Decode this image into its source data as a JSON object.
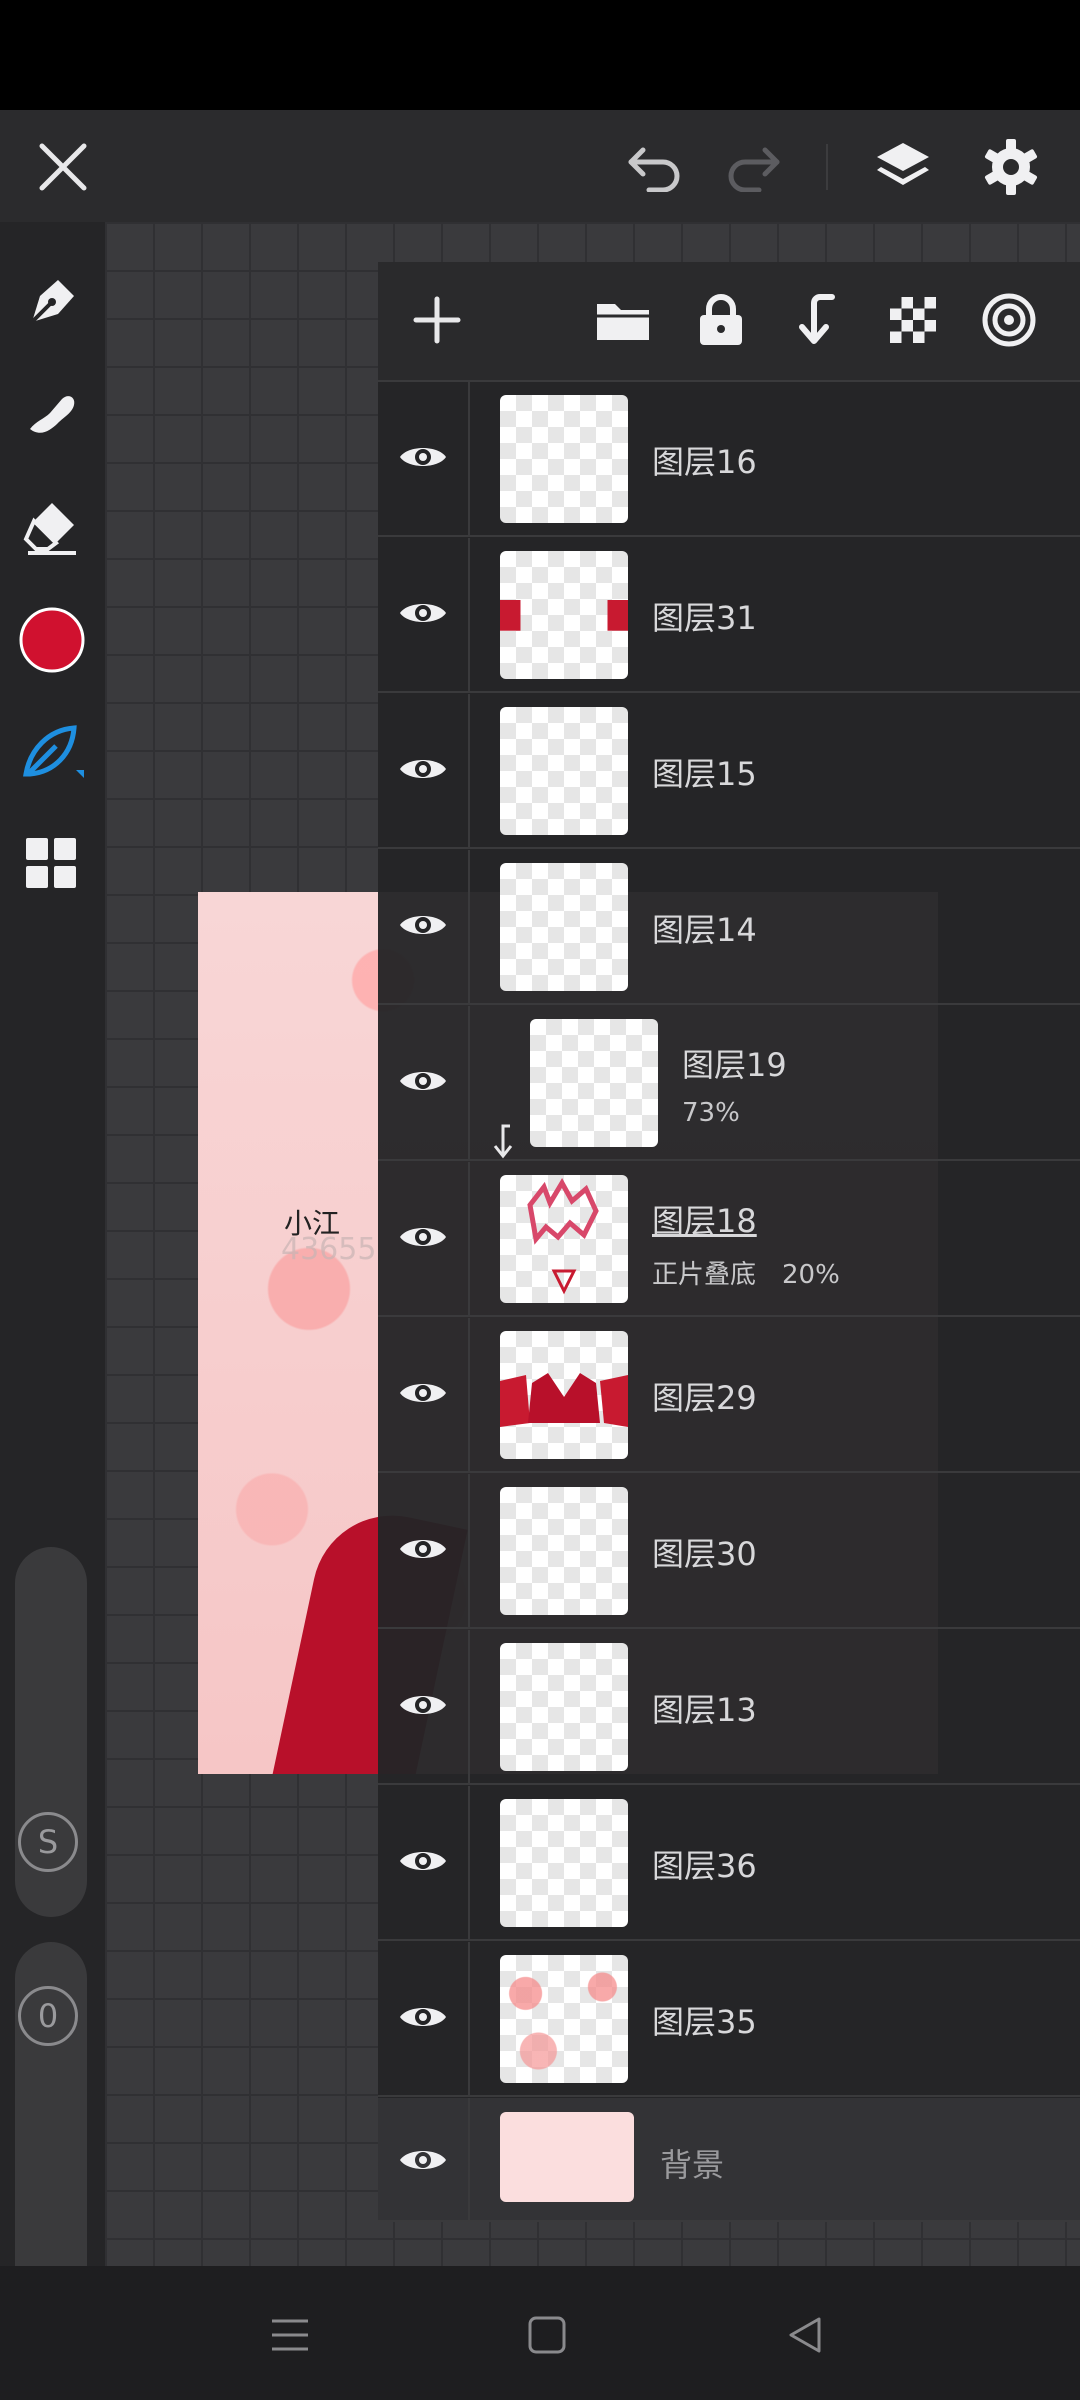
{
  "layers": [
    {
      "name": "图层16",
      "sub": "",
      "pct": ""
    },
    {
      "name": "图层31",
      "sub": "",
      "pct": ""
    },
    {
      "name": "图层15",
      "sub": "",
      "pct": ""
    },
    {
      "name": "图层14",
      "sub": "",
      "pct": ""
    },
    {
      "name": "图层19",
      "sub": "73%",
      "pct": ""
    },
    {
      "name": "图层18",
      "sub": "正片叠底",
      "pct": "20%"
    },
    {
      "name": "图层29",
      "sub": "",
      "pct": ""
    },
    {
      "name": "图层30",
      "sub": "",
      "pct": ""
    },
    {
      "name": "图层13",
      "sub": "",
      "pct": ""
    },
    {
      "name": "图层36",
      "sub": "",
      "pct": ""
    },
    {
      "name": "图层35",
      "sub": "",
      "pct": ""
    }
  ],
  "background_layer": {
    "name": "背景"
  },
  "artwork": {
    "name_text": "小江",
    "id_text": "43655"
  },
  "sliders": {
    "size_badge": "S",
    "opacity_badge": "0"
  },
  "colors": {
    "current_color": "#d0112f",
    "accent_blue": "#1e8fe0"
  },
  "icons": {
    "top_bar": [
      "close-icon",
      "undo-icon",
      "redo-icon",
      "layers-icon",
      "settings-icon"
    ],
    "tools": [
      "pen-icon",
      "smudge-icon",
      "eraser-icon",
      "color-swatch",
      "brush-leaf-icon",
      "grid-icon"
    ],
    "layer_toolbar": [
      "add-icon",
      "folder-icon",
      "lock-icon",
      "merge-down-icon",
      "transparency-icon",
      "layer-blend-icon"
    ]
  }
}
